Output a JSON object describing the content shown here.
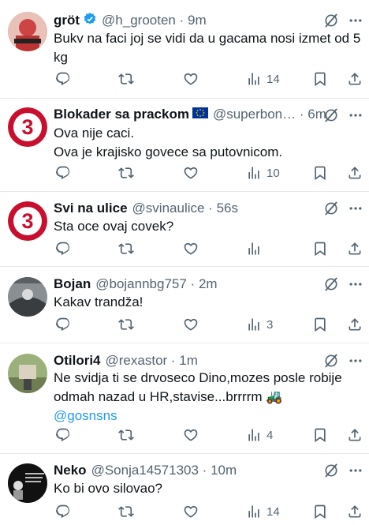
{
  "tweets": [
    {
      "name": "gröt",
      "verified": true,
      "handle": "@h_grooten",
      "time": "9m",
      "lines": [
        "Bukv na faci joj se vidi da u gacama nosi izmet od 5",
        "kg"
      ],
      "mention": "",
      "views": "14"
    },
    {
      "name": "Blokader sa prackom",
      "flag": "EU-flag",
      "handle": "@superbon…",
      "time": "6m",
      "lines": [
        "Ova nije caci.",
        "Ova je krajisko govece sa putovnicom."
      ],
      "mention": "",
      "views": "10"
    },
    {
      "name": "Svi na ulice",
      "handle": "@svinaulice",
      "time": "56s",
      "lines": [
        "Sta oce ovaj covek?"
      ],
      "mention": "",
      "views": ""
    },
    {
      "name": "Bojan",
      "handle": "@bojannbg757",
      "time": "2m",
      "lines": [
        "Kakav trandža!"
      ],
      "mention": "",
      "views": "3"
    },
    {
      "name": "Otilori4",
      "handle": "@rexastor",
      "time": "1m",
      "lines": [
        "Ne svidja ti se drvoseco Dino,mozes posle robije",
        "odmah nazad u HR,stavise...brrrrm 🚜"
      ],
      "mention": "@gosnsns",
      "views": "4"
    },
    {
      "name": "Neko",
      "handle": "@Sonja14571303",
      "time": "10m",
      "lines": [
        "Ko bi ovo silovao?"
      ],
      "mention": "",
      "views": "14"
    }
  ],
  "icons": {
    "reply": "reply-icon",
    "retweet": "retweet-icon",
    "like": "heart-icon",
    "views": "views-icon",
    "bookmark": "bookmark-icon",
    "share": "share-icon",
    "grok": "grok-icon",
    "more": "more-icon"
  },
  "colors": {
    "text": "#0f1419",
    "secondary": "#536471",
    "link": "#1d9bf0",
    "verified": "#1d9bf0",
    "divider": "#e6e9ec"
  }
}
